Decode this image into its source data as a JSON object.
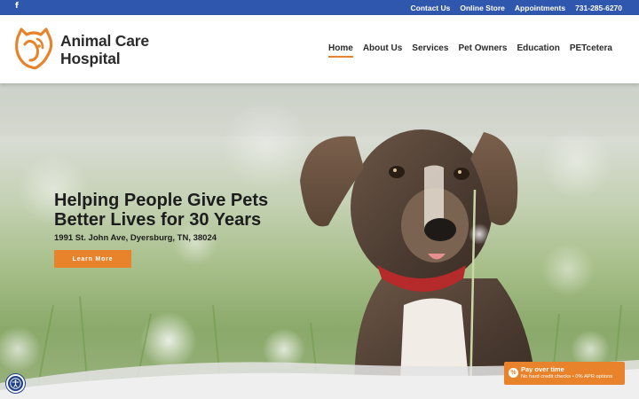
{
  "topbar": {
    "social_icon": "facebook-icon",
    "social_glyph": "f",
    "links": [
      "Contact Us",
      "Online Store",
      "Appointments",
      "731-285-6270"
    ],
    "bg_color": "#2f57ad"
  },
  "header": {
    "logo_line1": "Animal Care",
    "logo_line2": "Hospital",
    "logo_icon": "cat-dog-logo-icon",
    "nav": [
      "Home",
      "About Us",
      "Services",
      "Pet Owners",
      "Education",
      "PETcetera"
    ],
    "active_nav": "Home",
    "accent_color": "#e8822b"
  },
  "hero": {
    "title_line1": "Helping People Give Pets",
    "title_line2": "Better Lives for 30 Years",
    "address": "1991 St. John Ave, Dyersburg, TN, 38024",
    "button_label": "Learn More",
    "image": "puppy-in-meadow-photo"
  },
  "accessibility": {
    "icon": "accessibility-icon"
  },
  "pay_widget": {
    "title": "Pay over time",
    "subtitle": "No hard credit checks • 0% APR options",
    "icon": "percent-icon",
    "icon_glyph": "%"
  }
}
